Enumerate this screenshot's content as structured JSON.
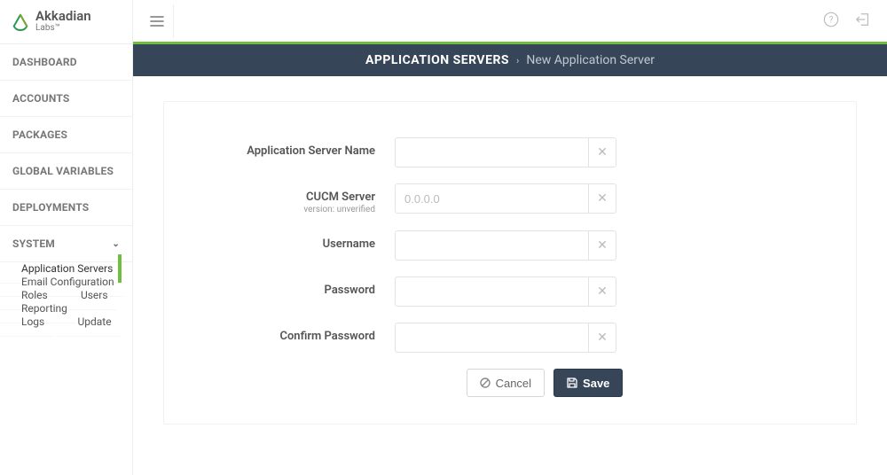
{
  "brand": {
    "name": "Akkadian",
    "sub": "Labs™"
  },
  "nav": {
    "items": [
      "DASHBOARD",
      "ACCOUNTS",
      "PACKAGES",
      "GLOBAL VARIABLES",
      "DEPLOYMENTS",
      "SYSTEM"
    ],
    "system_sub": [
      "Application Servers",
      "Email Configuration",
      "Roles",
      "Users",
      "Reporting",
      "Logs",
      "Update"
    ]
  },
  "breadcrumb": {
    "section": "APPLICATION SERVERS",
    "page": "New Application Server"
  },
  "form": {
    "server_name_label": "Application Server Name",
    "cucm_label": "CUCM Server",
    "cucm_sub": "version: unverified",
    "cucm_placeholder": "0.0.0.0",
    "username_label": "Username",
    "password_label": "Password",
    "confirm_label": "Confirm Password"
  },
  "buttons": {
    "cancel": "Cancel",
    "save": "Save"
  }
}
